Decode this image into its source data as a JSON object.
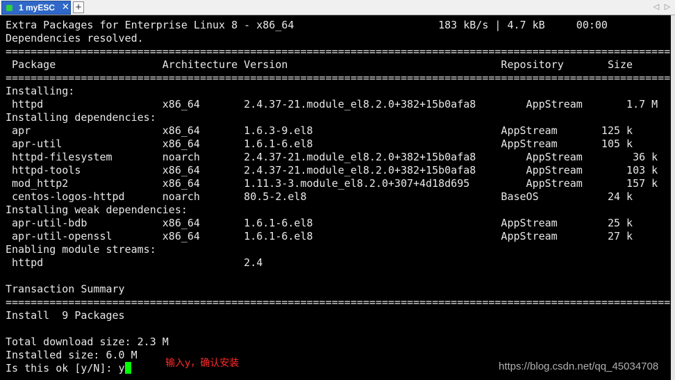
{
  "tab": {
    "label": "1 myESC",
    "close": "✕",
    "new_tab": "+"
  },
  "nav": {
    "left": "◁",
    "right": "▷"
  },
  "terminal": {
    "lines": [
      "Extra Packages for Enterprise Linux 8 - x86_64                       183 kB/s | 4.7 kB     00:00",
      "Dependencies resolved.",
      "==========================================================================================================",
      " Package                 Architecture Version                                  Repository       Size",
      "==========================================================================================================",
      "Installing:",
      " httpd                   x86_64       2.4.37-21.module_el8.2.0+382+15b0afa8        AppStream       1.7 M",
      "Installing dependencies:",
      " apr                     x86_64       1.6.3-9.el8                              AppStream       125 k",
      " apr-util                x86_64       1.6.1-6.el8                              AppStream       105 k",
      " httpd-filesystem        noarch       2.4.37-21.module_el8.2.0+382+15b0afa8        AppStream        36 k",
      " httpd-tools             x86_64       2.4.37-21.module_el8.2.0+382+15b0afa8        AppStream       103 k",
      " mod_http2               x86_64       1.11.3-3.module_el8.2.0+307+4d18d695         AppStream       157 k",
      " centos-logos-httpd      noarch       80.5-2.el8                               BaseOS           24 k",
      "Installing weak dependencies:",
      " apr-util-bdb            x86_64       1.6.1-6.el8                              AppStream        25 k",
      " apr-util-openssl        x86_64       1.6.1-6.el8                              AppStream        27 k",
      "Enabling module streams:",
      " httpd                                2.4",
      "",
      "Transaction Summary",
      "==========================================================================================================",
      "Install  9 Packages",
      "",
      "Total download size: 2.3 M",
      "Installed size: 6.0 M"
    ],
    "prompt": "Is this ok [y/N]: ",
    "input_value": "y"
  },
  "annotation": "输入y，确认安装",
  "watermark": "https://blog.csdn.net/qq_45034708"
}
